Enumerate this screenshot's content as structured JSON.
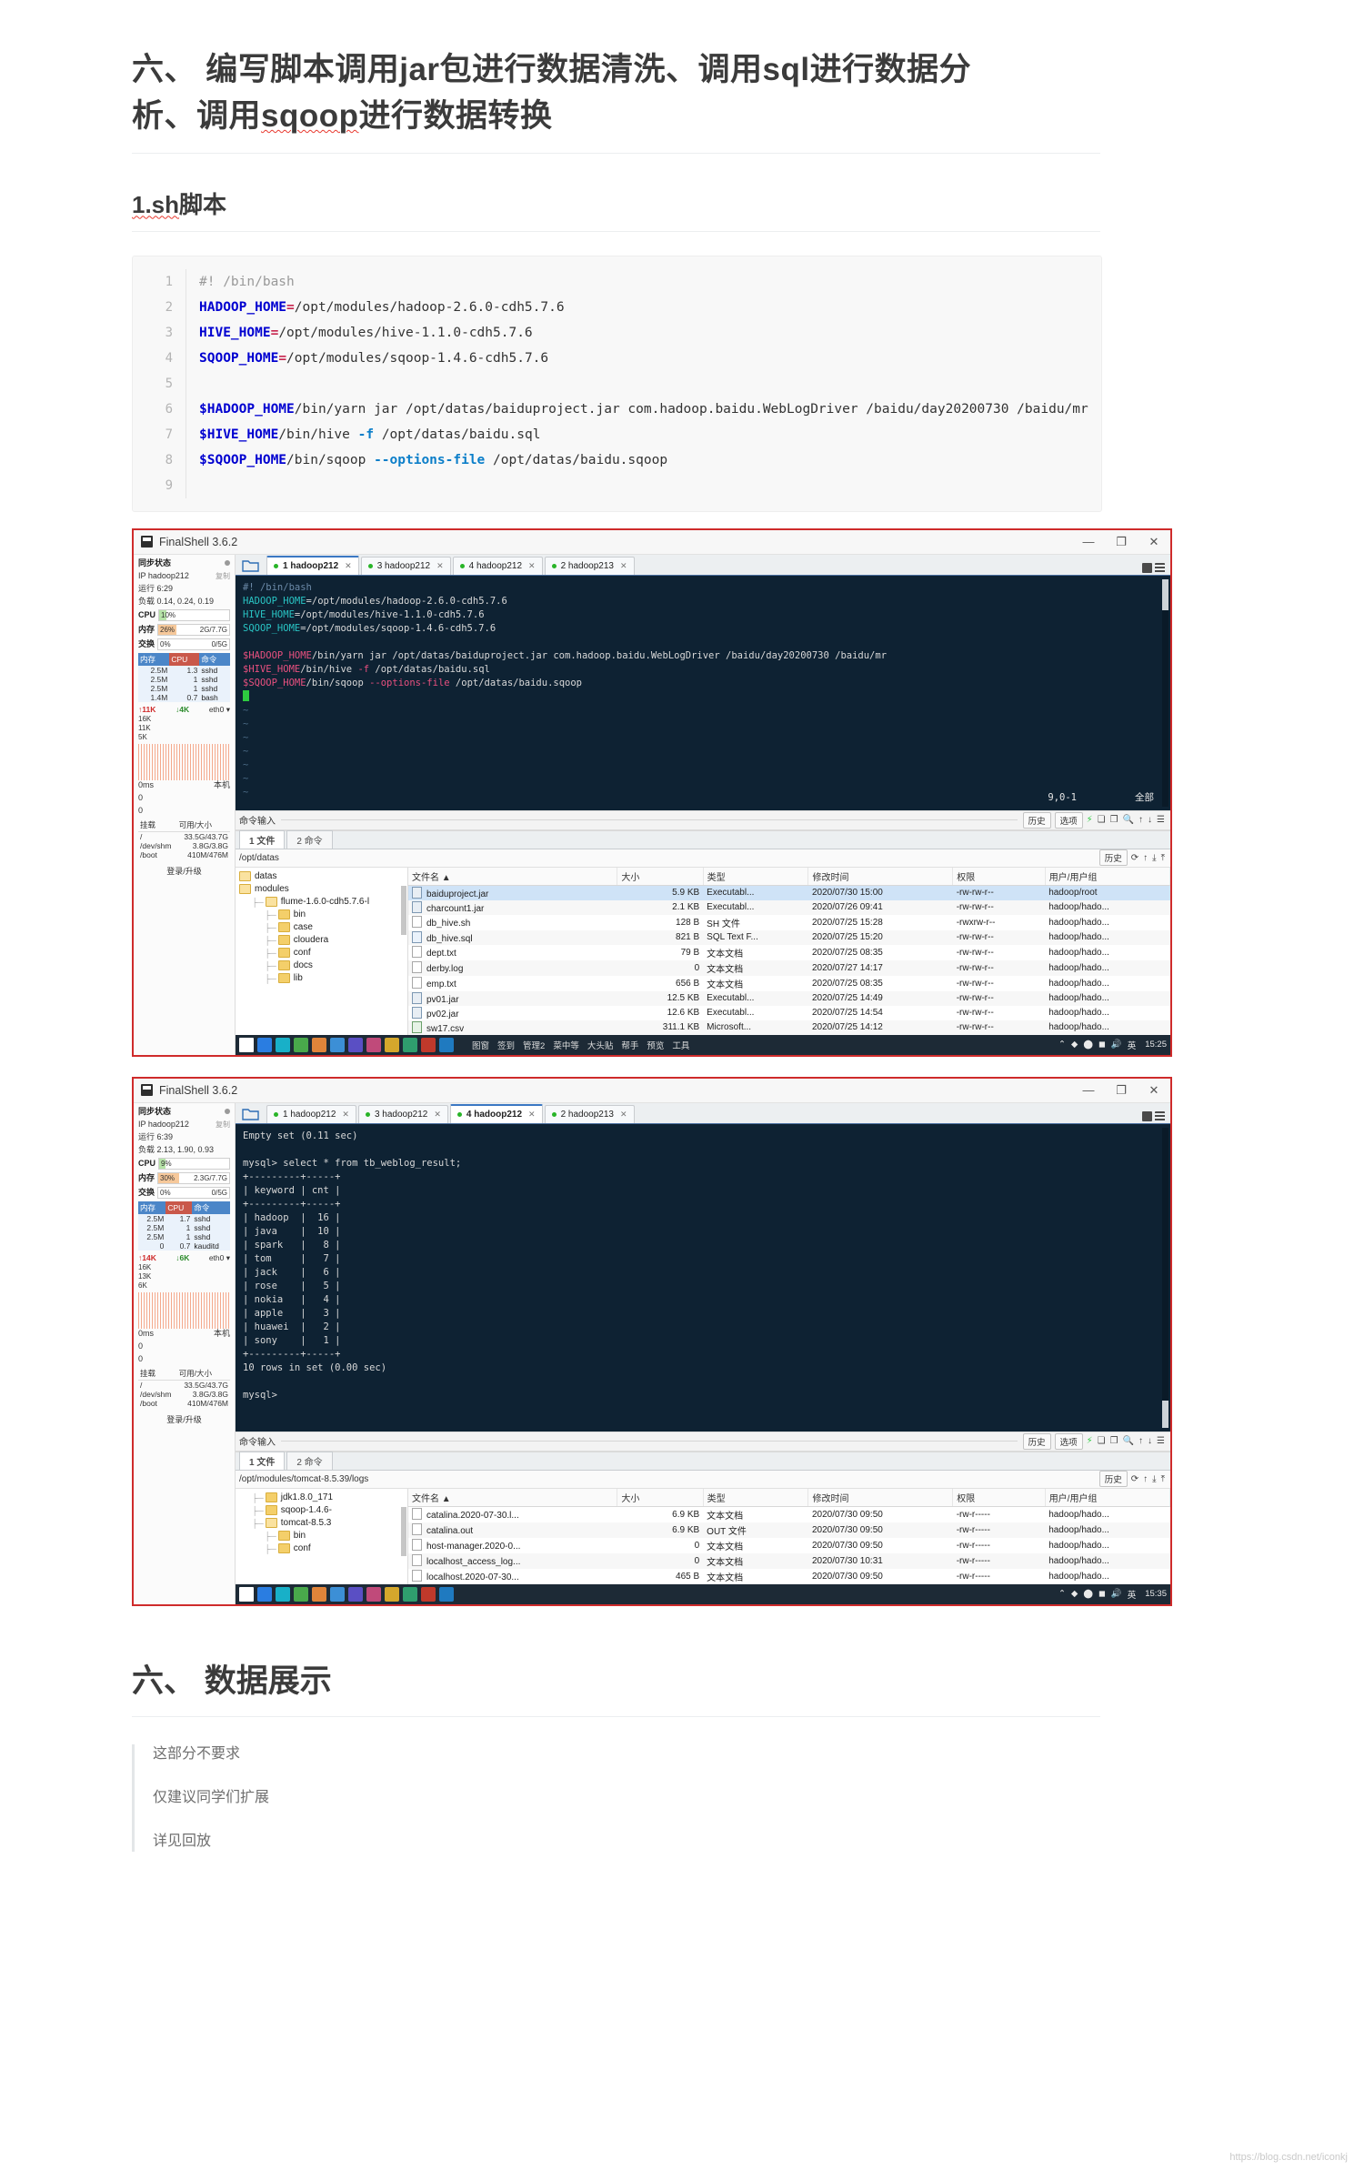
{
  "document": {
    "h1_main_part1": "六、 编写脚本调用jar包进行数据清洗、调用sql进行数据分",
    "h1_main_part2": "析、调用",
    "h1_main_sq": "sqoop",
    "h1_main_part3": "进行数据转换",
    "h2_section_sq": "1.sh",
    "h2_section_rest": "脚本",
    "h1_display": "六、 数据展示"
  },
  "code_block": {
    "lines": [
      {
        "n": "1",
        "segments": [
          {
            "t": "#! /bin/bash",
            "c": "c-com"
          }
        ]
      },
      {
        "n": "2",
        "segments": [
          {
            "t": "HADOOP_HOME",
            "c": "c-var"
          },
          {
            "t": "=",
            "c": "c-op"
          },
          {
            "t": "/opt/modules/hadoop-2.6.0-cdh5.7.6",
            "c": ""
          }
        ]
      },
      {
        "n": "3",
        "segments": [
          {
            "t": "HIVE_HOME",
            "c": "c-var"
          },
          {
            "t": "=",
            "c": "c-op"
          },
          {
            "t": "/opt/modules/hive-1.1.0-cdh5.7.6",
            "c": ""
          }
        ]
      },
      {
        "n": "4",
        "segments": [
          {
            "t": "SQOOP_HOME",
            "c": "c-var"
          },
          {
            "t": "=",
            "c": "c-op"
          },
          {
            "t": "/opt/modules/sqoop-1.4.6-cdh5.7.6",
            "c": ""
          }
        ]
      },
      {
        "n": "5",
        "segments": [
          {
            "t": "",
            "c": ""
          }
        ]
      },
      {
        "n": "6",
        "segments": [
          {
            "t": "$HADOOP_HOME",
            "c": "c-var"
          },
          {
            "t": "/bin/yarn jar /opt/datas/baiduproject.jar com.hadoop.baidu.WebLogDriver /baidu/day20200730 /baidu/mr",
            "c": ""
          }
        ]
      },
      {
        "n": "7",
        "segments": [
          {
            "t": "$HIVE_HOME",
            "c": "c-var"
          },
          {
            "t": "/bin/hive ",
            "c": ""
          },
          {
            "t": "-f",
            "c": "c-flag"
          },
          {
            "t": " /opt/datas/baidu.sql",
            "c": ""
          }
        ]
      },
      {
        "n": "8",
        "segments": [
          {
            "t": "$SQOOP_HOME",
            "c": "c-var"
          },
          {
            "t": "/bin/sqoop ",
            "c": ""
          },
          {
            "t": "--options-file",
            "c": "c-flag"
          },
          {
            "t": " /opt/datas/baidu.sqoop",
            "c": ""
          }
        ]
      },
      {
        "n": "9",
        "segments": [
          {
            "t": "",
            "c": ""
          }
        ]
      }
    ]
  },
  "shot1": {
    "titlebar": {
      "app": "FinalShell 3.6.2",
      "minimize": "—",
      "maximize": "❐",
      "close": "✕"
    },
    "sidebar": {
      "sync_label": "同步状态",
      "ip_label": "IP hadoop212",
      "copy_label": "复制",
      "uptime": "运行 6:29",
      "load": "负载 0.14, 0.24, 0.19",
      "cpu_label": "CPU",
      "cpu_pct": "10%",
      "cpu_right": "",
      "mem_label": "内存",
      "mem_pct": "26%",
      "mem_right": "2G/7.7G",
      "swap_label": "交换",
      "swap_pct": "0%",
      "swap_right": "0/5G",
      "proc_headers": [
        "内存",
        "CPU",
        "命令"
      ],
      "proc_rows": [
        [
          "2.5M",
          "1.3",
          "sshd"
        ],
        [
          "2.5M",
          "1",
          "sshd"
        ],
        [
          "2.5M",
          "1",
          "sshd"
        ],
        [
          "1.4M",
          "0.7",
          "bash"
        ]
      ],
      "net_up": "11K",
      "net_down": "4K",
      "net_iface": "eth0 ▾",
      "spark_labels": [
        "16K",
        "11K",
        "5K"
      ],
      "spark_zero_label": "0ms",
      "local_label": "本机",
      "zeros": [
        "0",
        "0"
      ],
      "disk_headers": [
        "挂载",
        "可用/大小"
      ],
      "disk_rows": [
        [
          "/",
          "33.5G/43.7G"
        ],
        [
          "/dev/shm",
          "3.8G/3.8G"
        ],
        [
          "/boot",
          "410M/476M"
        ]
      ],
      "footer": "登录/升级"
    },
    "tabs": [
      {
        "label": "1 hadoop212",
        "active": true
      },
      {
        "label": "3 hadoop212",
        "active": false
      },
      {
        "label": "4 hadoop212",
        "active": false
      },
      {
        "label": "2 hadoop213",
        "active": false
      }
    ],
    "terminal": {
      "lines": [
        [
          {
            "t": "#! /bin/bash",
            "c": "t-com"
          }
        ],
        [
          {
            "t": "HADOOP_HOME",
            "c": "t-var"
          },
          {
            "t": "=/opt/modules/hadoop-2.6.0-cdh5.7.6",
            "c": ""
          }
        ],
        [
          {
            "t": "HIVE_HOME",
            "c": "t-var"
          },
          {
            "t": "=/opt/modules/hive-1.1.0-cdh5.7.6",
            "c": ""
          }
        ],
        [
          {
            "t": "SQOOP_HOME",
            "c": "t-var"
          },
          {
            "t": "=/opt/modules/sqoop-1.4.6-cdh5.7.6",
            "c": ""
          }
        ],
        [
          {
            "t": "",
            "c": ""
          }
        ],
        [
          {
            "t": "$HADOOP_HOME",
            "c": "t-pink"
          },
          {
            "t": "/bin/yarn jar /opt/datas/baiduproject.jar com.hadoop.baidu.WebLogDriver /baidu/day20200730 /baidu/mr",
            "c": ""
          }
        ],
        [
          {
            "t": "$HIVE_HOME",
            "c": "t-pink"
          },
          {
            "t": "/bin/hive ",
            "c": ""
          },
          {
            "t": "-f",
            "c": "t-flag"
          },
          {
            "t": " /opt/datas/baidu.sql",
            "c": ""
          }
        ],
        [
          {
            "t": "$SQOOP_HOME",
            "c": "t-pink"
          },
          {
            "t": "/bin/sqoop ",
            "c": ""
          },
          {
            "t": "--options-file",
            "c": "t-flag"
          },
          {
            "t": " /opt/datas/baidu.sqoop",
            "c": ""
          }
        ]
      ],
      "tildes": [
        "~",
        "~",
        "~",
        "~",
        "~",
        "~",
        "~"
      ],
      "status_left": "9,0-1",
      "status_right": "全部"
    },
    "cmdbar": {
      "label": "命令输入",
      "history": "历史",
      "options": "选项"
    },
    "filemanager": {
      "tabs": [
        {
          "label": "1 文件",
          "active": true
        },
        {
          "label": "2 命令",
          "active": false
        }
      ],
      "path": "/opt/datas",
      "history_btn": "历史",
      "tree": [
        {
          "indent": 0,
          "label": "datas",
          "open": true
        },
        {
          "indent": 0,
          "label": "modules",
          "open": true
        },
        {
          "indent": 1,
          "label": "flume-1.6.0-cdh5.7.6-l",
          "open": true
        },
        {
          "indent": 2,
          "label": "bin",
          "open": false
        },
        {
          "indent": 2,
          "label": "case",
          "open": false
        },
        {
          "indent": 2,
          "label": "cloudera",
          "open": false
        },
        {
          "indent": 2,
          "label": "conf",
          "open": false
        },
        {
          "indent": 2,
          "label": "docs",
          "open": false
        },
        {
          "indent": 2,
          "label": "lib",
          "open": false
        }
      ],
      "headers": [
        "文件名 ▲",
        "大小",
        "类型",
        "修改时间",
        "权限",
        "用户/用户组"
      ],
      "rows": [
        {
          "icon": "jar",
          "name": "baiduproject.jar",
          "size": "5.9 KB",
          "type": "Executabl...",
          "mtime": "2020/07/30 15:00",
          "perm": "-rw-rw-r--",
          "owner": "hadoop/root",
          "selected": true
        },
        {
          "icon": "jar",
          "name": "charcount1.jar",
          "size": "2.1 KB",
          "type": "Executabl...",
          "mtime": "2020/07/26 09:41",
          "perm": "-rw-rw-r--",
          "owner": "hadoop/hado...",
          "selected": false
        },
        {
          "icon": "txt",
          "name": "db_hive.sh",
          "size": "128 B",
          "type": "SH 文件",
          "mtime": "2020/07/25 15:28",
          "perm": "-rwxrw-r--",
          "owner": "hadoop/hado...",
          "selected": false
        },
        {
          "icon": "sql",
          "name": "db_hive.sql",
          "size": "821 B",
          "type": "SQL Text F...",
          "mtime": "2020/07/25 15:20",
          "perm": "-rw-rw-r--",
          "owner": "hadoop/hado...",
          "selected": false
        },
        {
          "icon": "txt",
          "name": "dept.txt",
          "size": "79 B",
          "type": "文本文档",
          "mtime": "2020/07/25 08:35",
          "perm": "-rw-rw-r--",
          "owner": "hadoop/hado...",
          "selected": false
        },
        {
          "icon": "txt",
          "name": "derby.log",
          "size": "0",
          "type": "文本文档",
          "mtime": "2020/07/27 14:17",
          "perm": "-rw-rw-r--",
          "owner": "hadoop/hado...",
          "selected": false
        },
        {
          "icon": "txt",
          "name": "emp.txt",
          "size": "656 B",
          "type": "文本文档",
          "mtime": "2020/07/25 08:35",
          "perm": "-rw-rw-r--",
          "owner": "hadoop/hado...",
          "selected": false
        },
        {
          "icon": "jar",
          "name": "pv01.jar",
          "size": "12.5 KB",
          "type": "Executabl...",
          "mtime": "2020/07/25 14:49",
          "perm": "-rw-rw-r--",
          "owner": "hadoop/hado...",
          "selected": false
        },
        {
          "icon": "jar",
          "name": "pv02.jar",
          "size": "12.6 KB",
          "type": "Executabl...",
          "mtime": "2020/07/25 14:54",
          "perm": "-rw-rw-r--",
          "owner": "hadoop/hado...",
          "selected": false
        },
        {
          "icon": "xls",
          "name": "sw17.csv",
          "size": "311.1 KB",
          "type": "Microsoft...",
          "mtime": "2020/07/25 14:12",
          "perm": "-rw-rw-r--",
          "owner": "hadoop/hado...",
          "selected": false
        }
      ]
    },
    "taskbar": {
      "items": [
        "图窗",
        "签到",
        "管理2",
        "菜中等",
        "大头贴",
        "帮手",
        "预览",
        "工具"
      ],
      "lang": "英",
      "clock": "15:25"
    }
  },
  "shot2": {
    "titlebar": {
      "app": "FinalShell 3.6.2",
      "minimize": "—",
      "maximize": "❐",
      "close": "✕"
    },
    "sidebar": {
      "sync_label": "同步状态",
      "ip_label": "IP hadoop212",
      "copy_label": "复制",
      "uptime": "运行 6:39",
      "load": "负载 2.13, 1.90, 0.93",
      "cpu_label": "CPU",
      "cpu_pct": "9%",
      "cpu_right": "",
      "mem_label": "内存",
      "mem_pct": "30%",
      "mem_right": "2.3G/7.7G",
      "swap_label": "交换",
      "swap_pct": "0%",
      "swap_right": "0/5G",
      "proc_headers": [
        "内存",
        "CPU",
        "命令"
      ],
      "proc_rows": [
        [
          "2.5M",
          "1.7",
          "sshd"
        ],
        [
          "2.5M",
          "1",
          "sshd"
        ],
        [
          "2.5M",
          "1",
          "sshd"
        ],
        [
          "0",
          "0.7",
          "kauditd"
        ]
      ],
      "net_up": "14K",
      "net_down": "6K",
      "net_iface": "eth0 ▾",
      "spark_labels": [
        "16K",
        "13K",
        "6K"
      ],
      "spark_zero_label": "0ms",
      "local_label": "本机",
      "zeros": [
        "0",
        "0"
      ],
      "disk_headers": [
        "挂载",
        "可用/大小"
      ],
      "disk_rows": [
        [
          "/",
          "33.5G/43.7G"
        ],
        [
          "/dev/shm",
          "3.8G/3.8G"
        ],
        [
          "/boot",
          "410M/476M"
        ]
      ],
      "footer": "登录/升级"
    },
    "tabs": [
      {
        "label": "1 hadoop212",
        "active": false
      },
      {
        "label": "3 hadoop212",
        "active": false
      },
      {
        "label": "4 hadoop212",
        "active": true
      },
      {
        "label": "2 hadoop213",
        "active": false
      }
    ],
    "terminal": {
      "lines": [
        [
          {
            "t": "Empty set (0.11 sec)",
            "c": ""
          }
        ],
        [
          {
            "t": "",
            "c": ""
          }
        ],
        [
          {
            "t": "mysql> select * from tb_weblog_result;",
            "c": ""
          }
        ],
        [
          {
            "t": "+---------+-----+",
            "c": ""
          }
        ],
        [
          {
            "t": "| keyword | cnt |",
            "c": ""
          }
        ],
        [
          {
            "t": "+---------+-----+",
            "c": ""
          }
        ],
        [
          {
            "t": "| hadoop  |  16 |",
            "c": ""
          }
        ],
        [
          {
            "t": "| java    |  10 |",
            "c": ""
          }
        ],
        [
          {
            "t": "| spark   |   8 |",
            "c": ""
          }
        ],
        [
          {
            "t": "| tom     |   7 |",
            "c": ""
          }
        ],
        [
          {
            "t": "| jack    |   6 |",
            "c": ""
          }
        ],
        [
          {
            "t": "| rose    |   5 |",
            "c": ""
          }
        ],
        [
          {
            "t": "| nokia   |   4 |",
            "c": ""
          }
        ],
        [
          {
            "t": "| apple   |   3 |",
            "c": ""
          }
        ],
        [
          {
            "t": "| huawei  |   2 |",
            "c": ""
          }
        ],
        [
          {
            "t": "| sony    |   1 |",
            "c": ""
          }
        ],
        [
          {
            "t": "+---------+-----+",
            "c": ""
          }
        ],
        [
          {
            "t": "10 rows in set (0.00 sec)",
            "c": ""
          }
        ],
        [
          {
            "t": "",
            "c": ""
          }
        ],
        [
          {
            "t": "mysql>",
            "c": ""
          }
        ]
      ],
      "status_left": "",
      "status_right": ""
    },
    "cmdbar": {
      "label": "命令输入",
      "history": "历史",
      "options": "选项"
    },
    "filemanager": {
      "tabs": [
        {
          "label": "1 文件",
          "active": true
        },
        {
          "label": "2 命令",
          "active": false
        }
      ],
      "path": "/opt/modules/tomcat-8.5.39/logs",
      "history_btn": "历史",
      "tree": [
        {
          "indent": 1,
          "label": "jdk1.8.0_171",
          "open": false
        },
        {
          "indent": 1,
          "label": "sqoop-1.4.6-",
          "open": false
        },
        {
          "indent": 1,
          "label": "tomcat-8.5.3",
          "open": true
        },
        {
          "indent": 2,
          "label": "bin",
          "open": false
        },
        {
          "indent": 2,
          "label": "conf",
          "open": false
        }
      ],
      "headers": [
        "文件名 ▲",
        "大小",
        "类型",
        "修改时间",
        "权限",
        "用户/用户组"
      ],
      "rows": [
        {
          "icon": "txt",
          "name": "catalina.2020-07-30.l...",
          "size": "6.9 KB",
          "type": "文本文档",
          "mtime": "2020/07/30 09:50",
          "perm": "-rw-r-----",
          "owner": "hadoop/hado...",
          "selected": false
        },
        {
          "icon": "txt",
          "name": "catalina.out",
          "size": "6.9 KB",
          "type": "OUT 文件",
          "mtime": "2020/07/30 09:50",
          "perm": "-rw-r-----",
          "owner": "hadoop/hado...",
          "selected": false
        },
        {
          "icon": "txt",
          "name": "host-manager.2020-0...",
          "size": "0",
          "type": "文本文档",
          "mtime": "2020/07/30 09:50",
          "perm": "-rw-r-----",
          "owner": "hadoop/hado...",
          "selected": false
        },
        {
          "icon": "txt",
          "name": "localhost_access_log...",
          "size": "0",
          "type": "文本文档",
          "mtime": "2020/07/30 10:31",
          "perm": "-rw-r-----",
          "owner": "hadoop/hado...",
          "selected": false
        },
        {
          "icon": "txt",
          "name": "localhost.2020-07-30...",
          "size": "465 B",
          "type": "文本文档",
          "mtime": "2020/07/30 09:50",
          "perm": "-rw-r-----",
          "owner": "hadoop/hado...",
          "selected": false
        }
      ]
    },
    "taskbar": {
      "items": [],
      "lang": "英",
      "clock": "15:35"
    }
  },
  "quote": {
    "lines": [
      "这部分不要求",
      "仅建议同学们扩展",
      "详见回放"
    ]
  },
  "watermark": "https://blog.csdn.net/iconkj",
  "colors": {
    "red_frame": "#cf2b2b",
    "terminal_bg": "#0e2233",
    "accent_blue": "#3b78c3",
    "heading": "#3b3b3b"
  }
}
